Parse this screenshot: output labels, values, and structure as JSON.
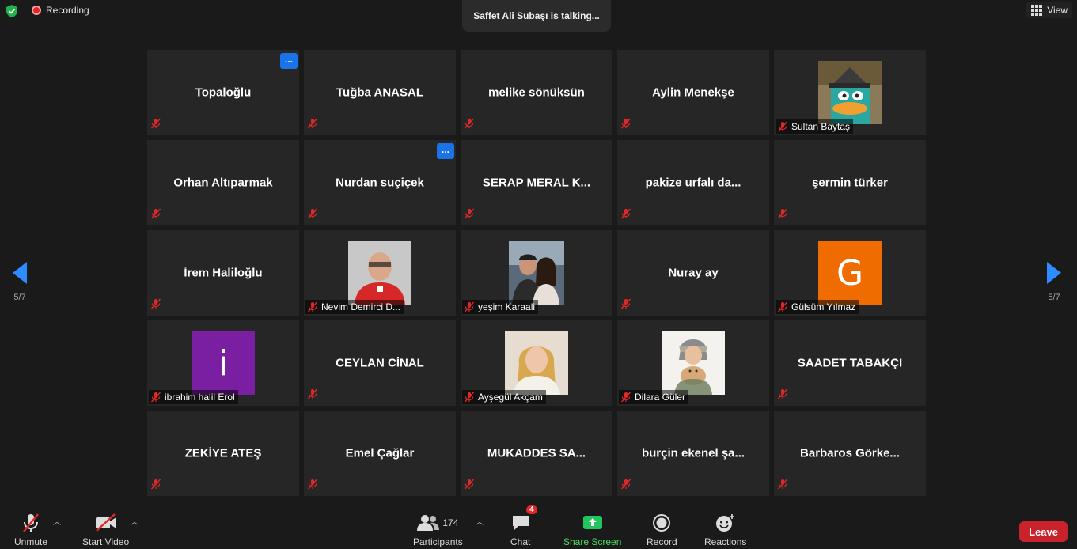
{
  "topbar": {
    "recording_label": "Recording",
    "talking_text": "Saffet Ali Subaşı is talking...",
    "view_label": "View"
  },
  "navigation": {
    "page_left": "5/7",
    "page_right": "5/7"
  },
  "tiles": [
    {
      "name": "Topaloğlu",
      "kind": "name",
      "more": true
    },
    {
      "name": "Tuğba ANASAL",
      "kind": "name"
    },
    {
      "name": "melike sönüksün",
      "kind": "name"
    },
    {
      "name": "Aylin Menekşe",
      "kind": "name"
    },
    {
      "name": "Sultan Baytaş",
      "kind": "avatar",
      "avatar": "cartoon-platypus"
    },
    {
      "name": "Orhan Altıparmak",
      "kind": "name"
    },
    {
      "name": "Nurdan suçiçek",
      "kind": "name",
      "more": true
    },
    {
      "name": "SERAP MERAL K...",
      "kind": "name"
    },
    {
      "name": "pakize urfalı da...",
      "kind": "name"
    },
    {
      "name": "şermin türker",
      "kind": "name"
    },
    {
      "name": "İrem Haliloğlu",
      "kind": "name"
    },
    {
      "name": "Nevim Demirci D...",
      "kind": "avatar",
      "avatar": "photo-man-red-shirt"
    },
    {
      "name": "yeşim Karaali",
      "kind": "avatar",
      "avatar": "photo-couple"
    },
    {
      "name": "Nuray ay",
      "kind": "name"
    },
    {
      "name": "Gülsüm Yılmaz",
      "kind": "avatar",
      "avatar": "letter",
      "letter": "G",
      "color": "#ee6c00"
    },
    {
      "name": "ibrahim halil Erol",
      "kind": "avatar",
      "avatar": "letter",
      "letter": "i",
      "color": "#7b1fa2"
    },
    {
      "name": "CEYLAN CİNAL",
      "kind": "name"
    },
    {
      "name": "Ayşegül Akçam",
      "kind": "avatar",
      "avatar": "photo-blonde-woman"
    },
    {
      "name": "Dilara Güler",
      "kind": "avatar",
      "avatar": "photo-woman-cat"
    },
    {
      "name": "SAADET TABAKÇI",
      "kind": "name"
    },
    {
      "name": "ZEKİYE ATEŞ",
      "kind": "name"
    },
    {
      "name": "Emel Çağlar",
      "kind": "name"
    },
    {
      "name": "MUKADDES SA...",
      "kind": "name"
    },
    {
      "name": "burçin ekenel şa...",
      "kind": "name"
    },
    {
      "name": "Barbaros Görke...",
      "kind": "name"
    }
  ],
  "toolbar": {
    "unmute_label": "Unmute",
    "start_video_label": "Start Video",
    "participants_label": "Participants",
    "participants_count": "174",
    "chat_label": "Chat",
    "chat_badge": "4",
    "share_label": "Share Screen",
    "record_label": "Record",
    "reactions_label": "Reactions",
    "leave_label": "Leave",
    "more_label": "..."
  },
  "colors": {
    "accent_blue": "#1a73e8",
    "leave_red": "#c8232b",
    "share_green": "#22c55e",
    "mute_red": "#e02828"
  }
}
